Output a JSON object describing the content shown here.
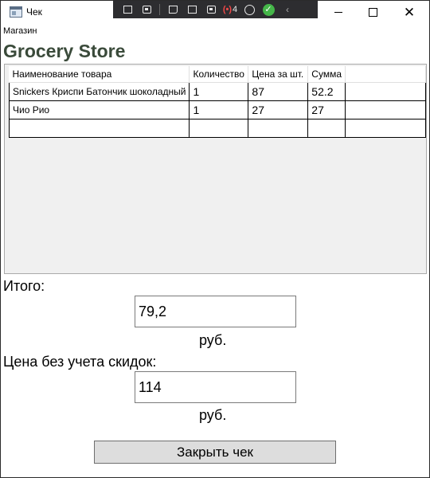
{
  "window": {
    "title": "Чек",
    "icon": "app-window-icon",
    "controls": {
      "minimize": "minimize-icon",
      "maximize": "maximize-icon",
      "close": "✕"
    }
  },
  "debug_toolbar": {
    "live_visual_tree_count": "4",
    "tools": [
      "live-visual-tree-icon",
      "go-to-live-visual-tree-icon",
      "select-element-icon",
      "display-layout-adorners-icon",
      "track-focused-element-icon",
      "hot-reload-icon",
      "accessibility-icon",
      "binding-ok-icon",
      "collapse-icon"
    ]
  },
  "store": {
    "label": "Магазин",
    "name": "Grocery Store"
  },
  "grid": {
    "columns": [
      "Наименование товара",
      "Количество",
      "Цена за шт.",
      "Сумма",
      ""
    ],
    "rows": [
      [
        "Snickers Криспи Батончик шоколадный",
        "1",
        "87",
        "52.2",
        ""
      ],
      [
        "Чио Рио",
        "1",
        "27",
        "27",
        ""
      ],
      [
        "",
        "",
        "",
        "",
        ""
      ]
    ]
  },
  "total": {
    "label": "Итого:",
    "value": "79,2",
    "unit": "руб."
  },
  "full_price": {
    "label": "Цена без учета скидок:",
    "value": "114",
    "unit": "руб."
  },
  "close_button": "Закрыть чек",
  "colors": {
    "store_name": "#3a4a3a",
    "grid_background": "#f0f0f0",
    "button_background": "#dddddd",
    "toolbar_background": "#2d2d30",
    "ok_icon": "#45b649"
  }
}
